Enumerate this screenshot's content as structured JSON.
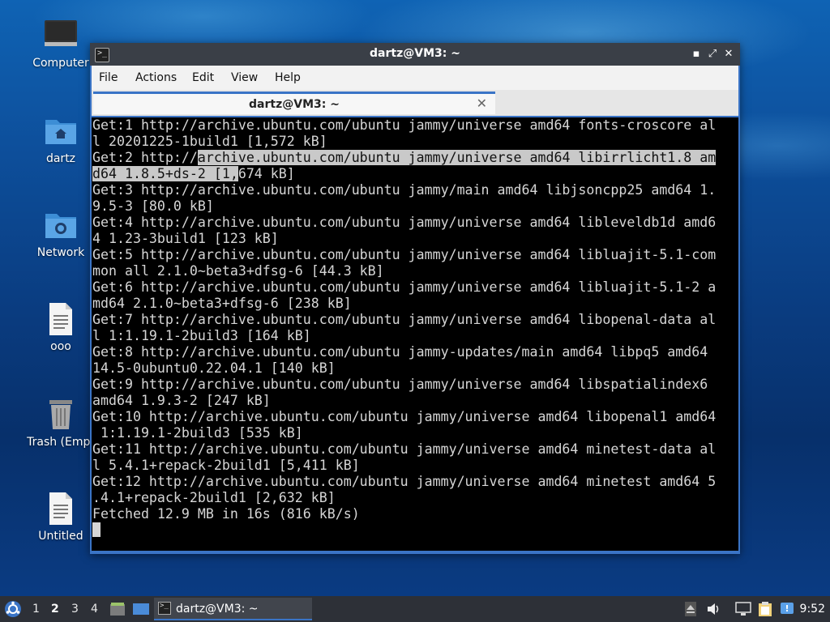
{
  "desktop": {
    "icons": [
      {
        "label": "Computer"
      },
      {
        "label": "dartz"
      },
      {
        "label": "Network"
      },
      {
        "label": "ooo"
      },
      {
        "label": "Trash (Empt"
      },
      {
        "label": "Untitled"
      }
    ]
  },
  "window": {
    "title": "dartz@VM3: ~",
    "controls": {
      "minimize": "▪",
      "maximize": "⤢",
      "close": "✕"
    },
    "menu": [
      "File",
      "Actions",
      "Edit",
      "View",
      "Help"
    ],
    "tab": {
      "label": "dartz@VM3: ~",
      "close": "✕"
    },
    "terminal": {
      "lines": [
        "Get:1 http://archive.ubuntu.com/ubuntu jammy/universe amd64 fonts-croscore al",
        "l 20201225-1build1 [1,572 kB]",
        "Get:2 http://",
        "archive.ubuntu.com/ubuntu jammy/universe amd64 libirrlicht1.8 am",
        "d64 1.8.5+ds-2 [1,",
        "674 kB]",
        "Get:3 http://archive.ubuntu.com/ubuntu jammy/main amd64 libjsoncpp25 amd64 1.",
        "9.5-3 [80.0 kB]",
        "Get:4 http://archive.ubuntu.com/ubuntu jammy/universe amd64 libleveldb1d amd6",
        "4 1.23-3build1 [123 kB]",
        "Get:5 http://archive.ubuntu.com/ubuntu jammy/universe amd64 libluajit-5.1-com",
        "mon all 2.1.0~beta3+dfsg-6 [44.3 kB]",
        "Get:6 http://archive.ubuntu.com/ubuntu jammy/universe amd64 libluajit-5.1-2 a",
        "md64 2.1.0~beta3+dfsg-6 [238 kB]",
        "Get:7 http://archive.ubuntu.com/ubuntu jammy/universe amd64 libopenal-data al",
        "l 1:1.19.1-2build3 [164 kB]",
        "Get:8 http://archive.ubuntu.com/ubuntu jammy-updates/main amd64 libpq5 amd64",
        "14.5-0ubuntu0.22.04.1 [140 kB]",
        "Get:9 http://archive.ubuntu.com/ubuntu jammy/universe amd64 libspatialindex6",
        "amd64 1.9.3-2 [247 kB]",
        "Get:10 http://archive.ubuntu.com/ubuntu jammy/universe amd64 libopenal1 amd64",
        " 1:1.19.1-2build3 [535 kB]",
        "Get:11 http://archive.ubuntu.com/ubuntu jammy/universe amd64 minetest-data al",
        "l 5.4.1+repack-2build1 [5,411 kB]",
        "Get:12 http://archive.ubuntu.com/ubuntu jammy/universe amd64 minetest amd64 5",
        ".4.1+repack-2build1 [2,632 kB]",
        "Fetched 12.9 MB in 16s (816 kB/s)"
      ]
    }
  },
  "taskbar": {
    "workspaces": [
      "1",
      "2",
      "3",
      "4"
    ],
    "active_workspace": "2",
    "task_label": "dartz@VM3: ~",
    "clock": "9:52",
    "icons": [
      "start-menu-icon",
      "file-manager-icon",
      "show-desktop-icon",
      "terminal-icon",
      "eject-icon",
      "volume-icon",
      "network-icon",
      "clipboard-icon",
      "notification-icon"
    ]
  },
  "colors": {
    "accent": "#3a74c6",
    "terminal_bg": "#000000",
    "terminal_fg": "#d6d6d6",
    "selection": "#c9c9c9"
  }
}
